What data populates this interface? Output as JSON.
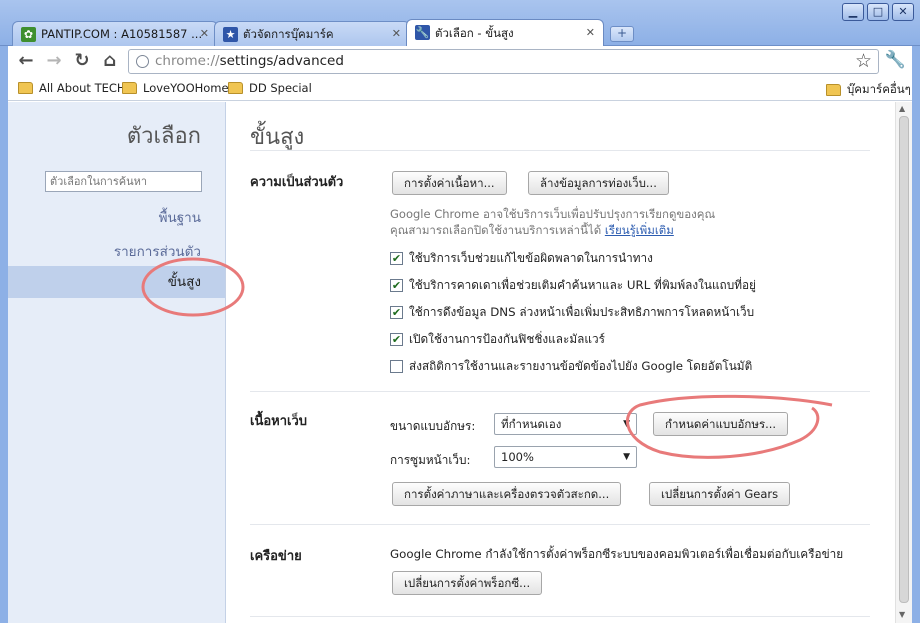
{
  "window": {
    "controls": [
      "▁",
      "□",
      "✕"
    ]
  },
  "tabs": [
    {
      "title": "PANTIP.COM : A10581587 ...",
      "favicon": "cactus-icon",
      "favicon_color": "#3f8f2f"
    },
    {
      "title": "ตัวจัดการบุ๊คมาร์ค",
      "favicon": "star-icon",
      "favicon_color": "#2f56a8"
    },
    {
      "title": "ตัวเลือก - ขั้นสูง",
      "favicon": "wrench-icon",
      "favicon_color": "#2f56a8"
    }
  ],
  "tab_close": "✕",
  "new_tab": "+",
  "toolbar": {
    "url_scheme": "chrome://",
    "url_rest": "settings/advanced"
  },
  "bookmarks": {
    "items": [
      "All About TECH",
      "LoveYOOHome",
      "DD Special"
    ],
    "other": "บุ๊คมาร์คอื่นๆ"
  },
  "nav": {
    "title": "ตัวเลือก",
    "search_placeholder": "ตัวเลือกในการค้นหา",
    "items": [
      "พื้นฐาน",
      "รายการส่วนตัว",
      "ขั้นสูง"
    ]
  },
  "main": {
    "title": "ขั้นสูง",
    "privacy": {
      "title": "ความเป็นส่วนตัว",
      "content_settings_button": "การตั้งค่าเนื้อหา...",
      "clear_data_button": "ล้างข้อมูลการท่องเว็บ...",
      "note_line1": "Google Chrome อาจใช้บริการเว็บเพื่อปรับปรุงการเรียกดูของคุณ",
      "note_line2": "คุณสามารถเลือกปิดใช้งานบริการเหล่านี้ได้",
      "learn_more": "เรียนรู้เพิ่มเติม",
      "checkboxes": [
        {
          "label": "ใช้บริการเว็บช่วยแก้ไขข้อผิดพลาดในการนำทาง",
          "checked": true
        },
        {
          "label": "ใช้บริการคาดเดาเพื่อช่วยเติมคำค้นหาและ URL ที่พิมพ์ลงในแถบที่อยู่",
          "checked": true
        },
        {
          "label": "ใช้การดึงข้อมูล DNS ล่วงหน้าเพื่อเพิ่มประสิทธิภาพการโหลดหน้าเว็บ",
          "checked": true
        },
        {
          "label": "เปิดใช้งานการป้องกันฟิชชิ่งและมัลแวร์",
          "checked": true
        },
        {
          "label": "ส่งสถิติการใช้งานและรายงานข้อขัดข้องไปยัง Google โดยอัตโนมัติ",
          "checked": false
        }
      ]
    },
    "web_content": {
      "title": "เนื้อหาเว็บ",
      "font_size_label": "ขนาดแบบอักษร:",
      "font_size_value": "ที่กำหนดเอง",
      "customize_fonts_button": "กำหนดค่าแบบอักษร...",
      "zoom_label": "การซูมหน้าเว็บ:",
      "zoom_value": "100%",
      "languages_button": "การตั้งค่าภาษาและเครื่องตรวจตัวสะกด...",
      "gears_button": "เปลี่ยนการตั้งค่า Gears"
    },
    "network": {
      "title": "เครือข่าย",
      "description": "Google Chrome กำลังใช้การตั้งค่าพร็อกซีระบบของคอมพิวเตอร์เพื่อเชื่อมต่อกับเครือข่าย",
      "proxy_button": "เปลี่ยนการตั้งค่าพร็อกซี..."
    }
  },
  "annotation_color": "#e87a7a"
}
